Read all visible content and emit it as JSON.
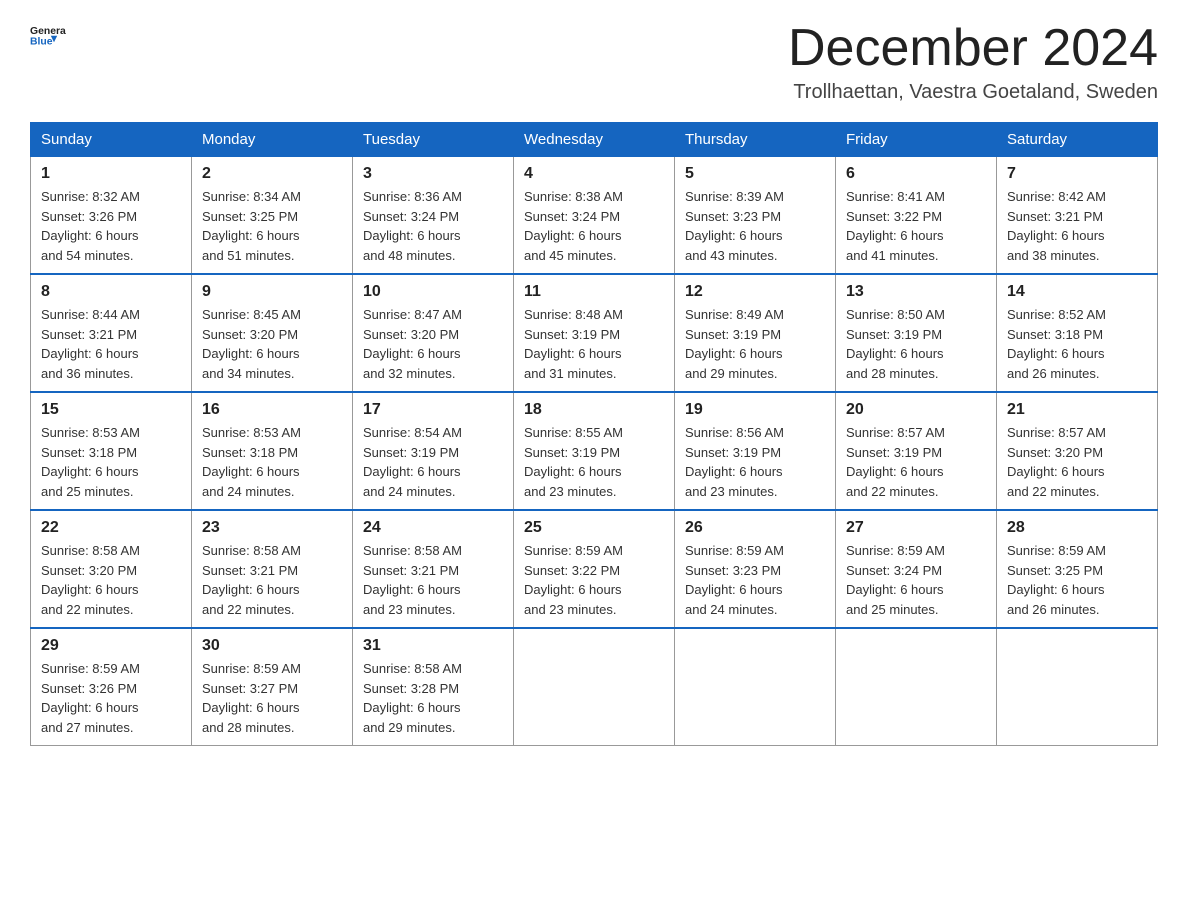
{
  "header": {
    "logo_general": "General",
    "logo_blue": "Blue",
    "month_title": "December 2024",
    "location": "Trollhaettan, Vaestra Goetaland, Sweden"
  },
  "days_of_week": [
    "Sunday",
    "Monday",
    "Tuesday",
    "Wednesday",
    "Thursday",
    "Friday",
    "Saturday"
  ],
  "weeks": [
    [
      {
        "day": "1",
        "sunrise": "8:32 AM",
        "sunset": "3:26 PM",
        "daylight": "6 hours and 54 minutes."
      },
      {
        "day": "2",
        "sunrise": "8:34 AM",
        "sunset": "3:25 PM",
        "daylight": "6 hours and 51 minutes."
      },
      {
        "day": "3",
        "sunrise": "8:36 AM",
        "sunset": "3:24 PM",
        "daylight": "6 hours and 48 minutes."
      },
      {
        "day": "4",
        "sunrise": "8:38 AM",
        "sunset": "3:24 PM",
        "daylight": "6 hours and 45 minutes."
      },
      {
        "day": "5",
        "sunrise": "8:39 AM",
        "sunset": "3:23 PM",
        "daylight": "6 hours and 43 minutes."
      },
      {
        "day": "6",
        "sunrise": "8:41 AM",
        "sunset": "3:22 PM",
        "daylight": "6 hours and 41 minutes."
      },
      {
        "day": "7",
        "sunrise": "8:42 AM",
        "sunset": "3:21 PM",
        "daylight": "6 hours and 38 minutes."
      }
    ],
    [
      {
        "day": "8",
        "sunrise": "8:44 AM",
        "sunset": "3:21 PM",
        "daylight": "6 hours and 36 minutes."
      },
      {
        "day": "9",
        "sunrise": "8:45 AM",
        "sunset": "3:20 PM",
        "daylight": "6 hours and 34 minutes."
      },
      {
        "day": "10",
        "sunrise": "8:47 AM",
        "sunset": "3:20 PM",
        "daylight": "6 hours and 32 minutes."
      },
      {
        "day": "11",
        "sunrise": "8:48 AM",
        "sunset": "3:19 PM",
        "daylight": "6 hours and 31 minutes."
      },
      {
        "day": "12",
        "sunrise": "8:49 AM",
        "sunset": "3:19 PM",
        "daylight": "6 hours and 29 minutes."
      },
      {
        "day": "13",
        "sunrise": "8:50 AM",
        "sunset": "3:19 PM",
        "daylight": "6 hours and 28 minutes."
      },
      {
        "day": "14",
        "sunrise": "8:52 AM",
        "sunset": "3:18 PM",
        "daylight": "6 hours and 26 minutes."
      }
    ],
    [
      {
        "day": "15",
        "sunrise": "8:53 AM",
        "sunset": "3:18 PM",
        "daylight": "6 hours and 25 minutes."
      },
      {
        "day": "16",
        "sunrise": "8:53 AM",
        "sunset": "3:18 PM",
        "daylight": "6 hours and 24 minutes."
      },
      {
        "day": "17",
        "sunrise": "8:54 AM",
        "sunset": "3:19 PM",
        "daylight": "6 hours and 24 minutes."
      },
      {
        "day": "18",
        "sunrise": "8:55 AM",
        "sunset": "3:19 PM",
        "daylight": "6 hours and 23 minutes."
      },
      {
        "day": "19",
        "sunrise": "8:56 AM",
        "sunset": "3:19 PM",
        "daylight": "6 hours and 23 minutes."
      },
      {
        "day": "20",
        "sunrise": "8:57 AM",
        "sunset": "3:19 PM",
        "daylight": "6 hours and 22 minutes."
      },
      {
        "day": "21",
        "sunrise": "8:57 AM",
        "sunset": "3:20 PM",
        "daylight": "6 hours and 22 minutes."
      }
    ],
    [
      {
        "day": "22",
        "sunrise": "8:58 AM",
        "sunset": "3:20 PM",
        "daylight": "6 hours and 22 minutes."
      },
      {
        "day": "23",
        "sunrise": "8:58 AM",
        "sunset": "3:21 PM",
        "daylight": "6 hours and 22 minutes."
      },
      {
        "day": "24",
        "sunrise": "8:58 AM",
        "sunset": "3:21 PM",
        "daylight": "6 hours and 23 minutes."
      },
      {
        "day": "25",
        "sunrise": "8:59 AM",
        "sunset": "3:22 PM",
        "daylight": "6 hours and 23 minutes."
      },
      {
        "day": "26",
        "sunrise": "8:59 AM",
        "sunset": "3:23 PM",
        "daylight": "6 hours and 24 minutes."
      },
      {
        "day": "27",
        "sunrise": "8:59 AM",
        "sunset": "3:24 PM",
        "daylight": "6 hours and 25 minutes."
      },
      {
        "day": "28",
        "sunrise": "8:59 AM",
        "sunset": "3:25 PM",
        "daylight": "6 hours and 26 minutes."
      }
    ],
    [
      {
        "day": "29",
        "sunrise": "8:59 AM",
        "sunset": "3:26 PM",
        "daylight": "6 hours and 27 minutes."
      },
      {
        "day": "30",
        "sunrise": "8:59 AM",
        "sunset": "3:27 PM",
        "daylight": "6 hours and 28 minutes."
      },
      {
        "day": "31",
        "sunrise": "8:58 AM",
        "sunset": "3:28 PM",
        "daylight": "6 hours and 29 minutes."
      },
      null,
      null,
      null,
      null
    ]
  ]
}
